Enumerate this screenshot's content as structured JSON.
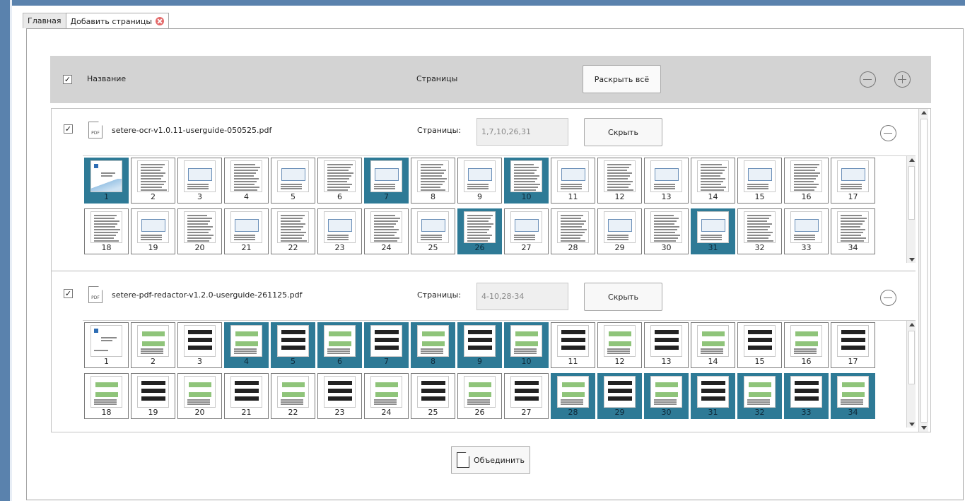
{
  "tabs": [
    {
      "label": "Главная",
      "active": false
    },
    {
      "label": "Добавить страницы",
      "active": true,
      "closable": true
    }
  ],
  "header": {
    "checked": true,
    "name_label": "Название",
    "pages_label": "Страницы",
    "expand_all_label": "Раскрыть всё"
  },
  "files": [
    {
      "checked": true,
      "icon_text": "PDF",
      "name": "setere-ocr-v1.0.11-userguide-050525.pdf",
      "pages_label": "Страницы:",
      "pages_value": "1,7,10,26,31",
      "hide_label": "Скрыть",
      "selected_pages": [
        1,
        7,
        10,
        26,
        31
      ],
      "pages": [
        "1",
        "2",
        "3",
        "4",
        "5",
        "6",
        "7",
        "8",
        "9",
        "10",
        "11",
        "12",
        "13",
        "14",
        "15",
        "16",
        "17",
        "18",
        "19",
        "20",
        "21",
        "22",
        "23",
        "24",
        "25",
        "26",
        "27",
        "28",
        "29",
        "30",
        "31",
        "32",
        "33",
        "34"
      ]
    },
    {
      "checked": true,
      "icon_text": "PDF",
      "name": "setere-pdf-redactor-v1.2.0-userguide-261125.pdf",
      "pages_label": "Страницы:",
      "pages_value": "4-10,28-34",
      "hide_label": "Скрыть",
      "selected_pages": [
        4,
        5,
        6,
        7,
        8,
        9,
        10,
        28,
        29,
        30,
        31,
        32,
        33,
        34
      ],
      "pages": [
        "1",
        "2",
        "3",
        "4",
        "5",
        "6",
        "7",
        "8",
        "9",
        "10",
        "11",
        "12",
        "13",
        "14",
        "15",
        "16",
        "17",
        "18",
        "19",
        "20",
        "21",
        "22",
        "23",
        "24",
        "25",
        "26",
        "27",
        "28",
        "29",
        "30",
        "31",
        "32",
        "33",
        "34"
      ]
    }
  ],
  "merge_label": "Объединить",
  "colors": {
    "selected": "#2e7a96",
    "header_bg": "#d3d3d3",
    "window_accent": "#5a82ad"
  }
}
